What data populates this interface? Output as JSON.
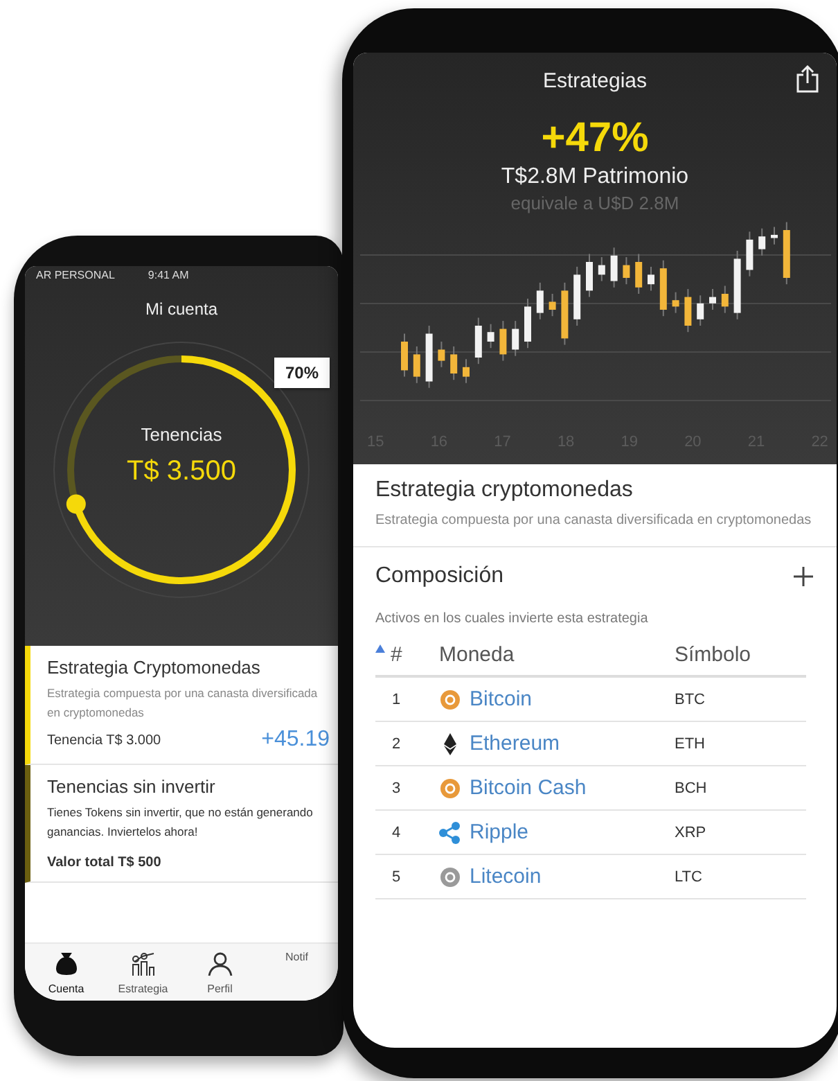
{
  "account": {
    "status_bar": {
      "carrier": "AR PERSONAL",
      "time": "9:41 AM"
    },
    "title": "Mi cuenta",
    "ring": {
      "level": 0.7,
      "badge": "70%",
      "label": "Tenencias",
      "value": "T$ 3.500"
    },
    "cards": [
      {
        "title": "Estrategia Cryptomonedas",
        "description": "Estrategia compuesta por una canasta diversificada en cryptomonedas",
        "footer": "Tenencia T$ 3.000",
        "change": "+45.19",
        "color": "#f5d90a"
      },
      {
        "title": "Tenencias sin invertir",
        "description": "Tienes Tokens sin invertir, que no están generando ganancias. Inviertelos ahora!",
        "footer": "Valor total T$ 500",
        "color": "#6b5f10"
      }
    ],
    "tabs": [
      {
        "label": "Cuenta",
        "selected": true
      },
      {
        "label": "Estrategia",
        "selected": false
      },
      {
        "label": "Perfil",
        "selected": false
      },
      {
        "label": "Notif",
        "selected": false
      }
    ]
  },
  "strategy": {
    "title": "Estrategias",
    "change": "+47%",
    "equity": "T$2.8M Patrimonio",
    "equivalent": "equivale a U$D 2.8M",
    "chart_x_labels": [
      "15",
      "16",
      "17",
      "18",
      "19",
      "20",
      "21",
      "22"
    ],
    "section_title": "Estrategia cryptomonedas",
    "section_description": "Estrategia compuesta por una canasta diversificada en cryptomonedas",
    "composition": {
      "title": "Composición",
      "subtitle": "Activos en los cuales invierte esta estrategia",
      "columns": [
        "#",
        "Moneda",
        "Símbolo"
      ],
      "rows": [
        {
          "number": "1",
          "name": "Bitcoin",
          "symbol": "BTC",
          "kind": "coin",
          "color": "#e8993a"
        },
        {
          "number": "2",
          "name": "Ethereum",
          "symbol": "ETH",
          "kind": "diamond",
          "color": "#222222"
        },
        {
          "number": "3",
          "name": "Bitcoin Cash",
          "symbol": "BCH",
          "kind": "coin",
          "color": "#e8993a"
        },
        {
          "number": "4",
          "name": "Ripple",
          "symbol": "XRP",
          "kind": "nodes",
          "color": "#2f8fd8"
        },
        {
          "number": "5",
          "name": "Litecoin",
          "symbol": "LTC",
          "kind": "coin",
          "color": "#9a9a9a"
        }
      ]
    }
  }
}
